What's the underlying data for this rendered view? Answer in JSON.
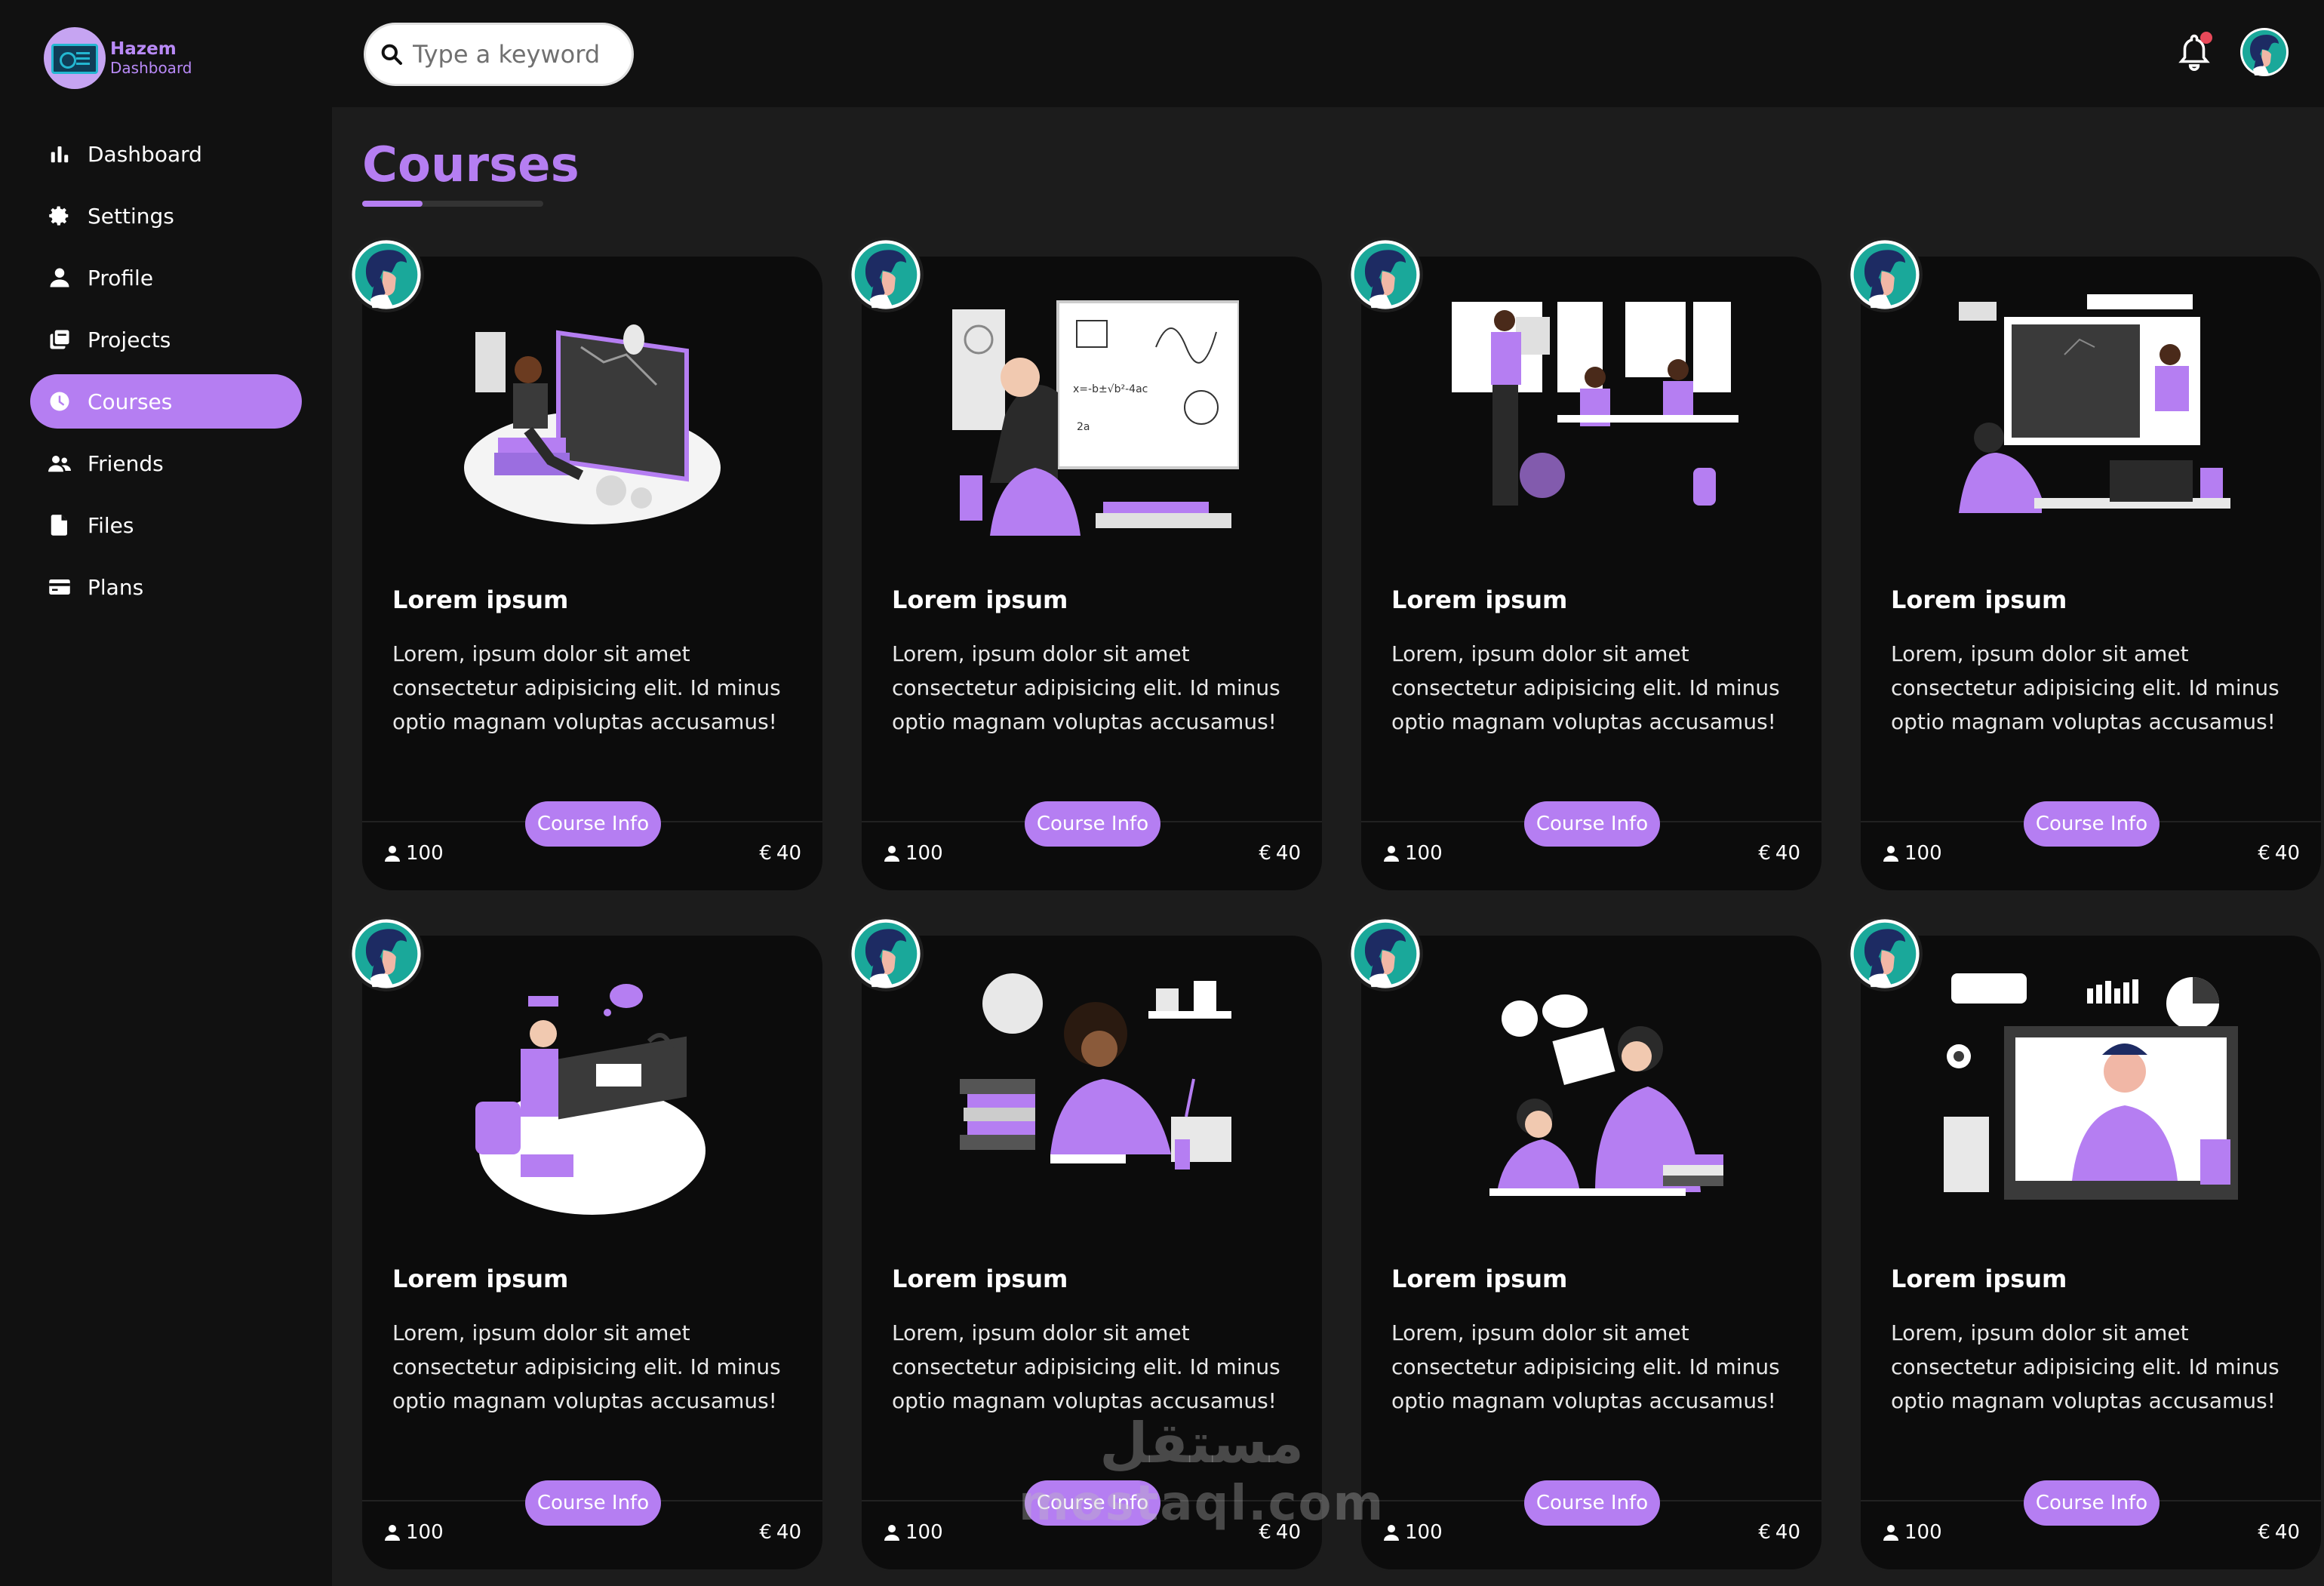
{
  "app": {
    "logo_line1": "Hazem",
    "logo_line2": "Dashboard"
  },
  "sidebar": {
    "items": [
      {
        "label": "Dashboard",
        "icon": "chart-bar-icon",
        "active": false
      },
      {
        "label": "Settings",
        "icon": "gear-icon",
        "active": false
      },
      {
        "label": "Profile",
        "icon": "user-icon",
        "active": false
      },
      {
        "label": "Projects",
        "icon": "clone-icon",
        "active": false
      },
      {
        "label": "Courses",
        "icon": "clock-icon",
        "active": true
      },
      {
        "label": "Friends",
        "icon": "users-icon",
        "active": false
      },
      {
        "label": "Files",
        "icon": "file-icon",
        "active": false
      },
      {
        "label": "Plans",
        "icon": "credit-card-icon",
        "active": false
      }
    ]
  },
  "header": {
    "search_placeholder": "Type a keyword",
    "notification_icon": "bell-icon",
    "has_notification": true
  },
  "main": {
    "title": "Courses",
    "courses": [
      {
        "title": "Lorem ipsum",
        "desc": "Lorem, ipsum dolor sit amet consectetur adipisicing elit. Id minus optio magnam voluptas accusamus!",
        "button": "Course Info",
        "students": "100",
        "currency": "€",
        "price": "40"
      },
      {
        "title": "Lorem ipsum",
        "desc": "Lorem, ipsum dolor sit amet consectetur adipisicing elit. Id minus optio magnam voluptas accusamus!",
        "button": "Course Info",
        "students": "100",
        "currency": "€",
        "price": "40"
      },
      {
        "title": "Lorem ipsum",
        "desc": "Lorem, ipsum dolor sit amet consectetur adipisicing elit. Id minus optio magnam voluptas accusamus!",
        "button": "Course Info",
        "students": "100",
        "currency": "€",
        "price": "40"
      },
      {
        "title": "Lorem ipsum",
        "desc": "Lorem, ipsum dolor sit amet consectetur adipisicing elit. Id minus optio magnam voluptas accusamus!",
        "button": "Course Info",
        "students": "100",
        "currency": "€",
        "price": "40"
      },
      {
        "title": "Lorem ipsum",
        "desc": "Lorem, ipsum dolor sit amet consectetur adipisicing elit. Id minus optio magnam voluptas accusamus!",
        "button": "Course Info",
        "students": "100",
        "currency": "€",
        "price": "40"
      },
      {
        "title": "Lorem ipsum",
        "desc": "Lorem, ipsum dolor sit amet consectetur adipisicing elit. Id minus optio magnam voluptas accusamus!",
        "button": "Course Info",
        "students": "100",
        "currency": "€",
        "price": "40"
      },
      {
        "title": "Lorem ipsum",
        "desc": "Lorem, ipsum dolor sit amet consectetur adipisicing elit. Id minus optio magnam voluptas accusamus!",
        "button": "Course Info",
        "students": "100",
        "currency": "€",
        "price": "40"
      },
      {
        "title": "Lorem ipsum",
        "desc": "Lorem, ipsum dolor sit amet consectetur adipisicing elit. Id minus optio magnam voluptas accusamus!",
        "button": "Course Info",
        "students": "100",
        "currency": "€",
        "price": "40"
      }
    ]
  },
  "watermark": {
    "arabic": "مستقل",
    "latin": "mostaql.com"
  },
  "colors": {
    "accent": "#b57ef2",
    "sidebar_bg": "#111111",
    "page_bg": "#1c1c1c",
    "card_bg": "#0c0c0c",
    "notification_dot": "#e8495a"
  }
}
